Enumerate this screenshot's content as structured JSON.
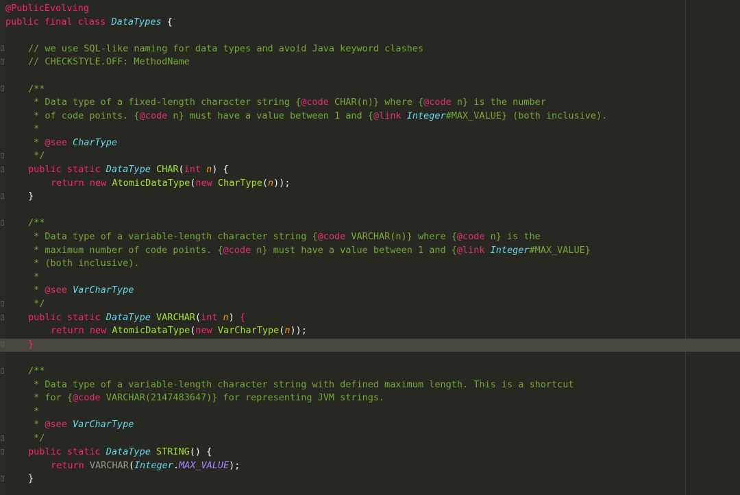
{
  "editor": {
    "lines": [
      [
        {
          "t": "@PublicEvolving",
          "c": "ann"
        }
      ],
      [
        {
          "t": "public final class ",
          "c": "kw"
        },
        {
          "t": "DataTypes",
          "c": "type"
        },
        {
          "t": " {",
          "c": "pun"
        }
      ],
      [],
      [
        {
          "t": "// we use SQL-like naming for data types and avoid Java keyword clashes",
          "c": "cm"
        }
      ],
      [
        {
          "t": "// CHECKSTYLE.OFF: MethodName",
          "c": "cm"
        }
      ],
      [],
      [
        {
          "t": "/**",
          "c": "cm"
        }
      ],
      [
        {
          "t": " * Data type of a fixed-length character string {",
          "c": "cm"
        },
        {
          "t": "@code",
          "c": "tag"
        },
        {
          "t": " CHAR(n)} where {",
          "c": "cm"
        },
        {
          "t": "@code",
          "c": "tag"
        },
        {
          "t": " n} is the number",
          "c": "cm"
        }
      ],
      [
        {
          "t": " * of code points. {",
          "c": "cm"
        },
        {
          "t": "@code",
          "c": "tag"
        },
        {
          "t": " n} must have a value between 1 and {",
          "c": "cm"
        },
        {
          "t": "@link",
          "c": "tag"
        },
        {
          "t": " Integer",
          "c": "link"
        },
        {
          "t": "#MAX_VALUE} (both inclusive).",
          "c": "cm"
        }
      ],
      [
        {
          "t": " *",
          "c": "cm"
        }
      ],
      [
        {
          "t": " * ",
          "c": "cm"
        },
        {
          "t": "@see",
          "c": "tag"
        },
        {
          "t": " CharType",
          "c": "link"
        }
      ],
      [
        {
          "t": " */",
          "c": "cm"
        }
      ],
      [
        {
          "t": "public static ",
          "c": "kw"
        },
        {
          "t": "DataType",
          "c": "type"
        },
        {
          "t": " CHAR",
          "c": "fn"
        },
        {
          "t": "(",
          "c": "pun"
        },
        {
          "t": "int",
          "c": "kw"
        },
        {
          "t": " n",
          "c": "par"
        },
        {
          "t": ") {",
          "c": "pun"
        }
      ],
      [
        {
          "t": "return new ",
          "c": "kw"
        },
        {
          "t": "AtomicDataType",
          "c": "fn"
        },
        {
          "t": "(",
          "c": "pun"
        },
        {
          "t": "new ",
          "c": "kw"
        },
        {
          "t": "CharType",
          "c": "fn"
        },
        {
          "t": "(",
          "c": "pun"
        },
        {
          "t": "n",
          "c": "par"
        },
        {
          "t": "));",
          "c": "pun"
        }
      ],
      [
        {
          "t": "}",
          "c": "pun"
        }
      ],
      [],
      [
        {
          "t": "/**",
          "c": "cm"
        }
      ],
      [
        {
          "t": " * Data type of a variable-length character string {",
          "c": "cm"
        },
        {
          "t": "@code",
          "c": "tag"
        },
        {
          "t": " VARCHAR(n)} where {",
          "c": "cm"
        },
        {
          "t": "@code",
          "c": "tag"
        },
        {
          "t": " n} is the",
          "c": "cm"
        }
      ],
      [
        {
          "t": " * maximum number of code points. {",
          "c": "cm"
        },
        {
          "t": "@code",
          "c": "tag"
        },
        {
          "t": " n} must have a value between 1 and {",
          "c": "cm"
        },
        {
          "t": "@link",
          "c": "tag"
        },
        {
          "t": " Integer",
          "c": "link"
        },
        {
          "t": "#MAX_VALUE}",
          "c": "cm"
        }
      ],
      [
        {
          "t": " * (both inclusive).",
          "c": "cm"
        }
      ],
      [
        {
          "t": " *",
          "c": "cm"
        }
      ],
      [
        {
          "t": " * ",
          "c": "cm"
        },
        {
          "t": "@see",
          "c": "tag"
        },
        {
          "t": " VarCharType",
          "c": "link"
        }
      ],
      [
        {
          "t": " */",
          "c": "cm"
        }
      ],
      [
        {
          "t": "public static ",
          "c": "kw"
        },
        {
          "t": "DataType",
          "c": "type"
        },
        {
          "t": " VARCHAR",
          "c": "fn"
        },
        {
          "t": "(",
          "c": "pun"
        },
        {
          "t": "int",
          "c": "kw"
        },
        {
          "t": " n",
          "c": "par"
        },
        {
          "t": ") ",
          "c": "pun"
        },
        {
          "t": "{",
          "c": "ann"
        }
      ],
      [
        {
          "t": "return new ",
          "c": "kw"
        },
        {
          "t": "AtomicDataType",
          "c": "fn"
        },
        {
          "t": "(",
          "c": "pun"
        },
        {
          "t": "new ",
          "c": "kw"
        },
        {
          "t": "VarCharType",
          "c": "fn"
        },
        {
          "t": "(",
          "c": "pun"
        },
        {
          "t": "n",
          "c": "par"
        },
        {
          "t": "));",
          "c": "pun"
        }
      ],
      [
        {
          "t": "}",
          "c": "ann"
        }
      ],
      [],
      [
        {
          "t": "/**",
          "c": "cm"
        }
      ],
      [
        {
          "t": " * Data type of a variable-length character string with defined maximum length. This is a shortcut",
          "c": "cm"
        }
      ],
      [
        {
          "t": " * for {",
          "c": "cm"
        },
        {
          "t": "@code",
          "c": "tag"
        },
        {
          "t": " VARCHAR(2147483647)} for representing JVM strings.",
          "c": "cm"
        }
      ],
      [
        {
          "t": " *",
          "c": "cm"
        }
      ],
      [
        {
          "t": " * ",
          "c": "cm"
        },
        {
          "t": "@see",
          "c": "tag"
        },
        {
          "t": " VarCharType",
          "c": "link"
        }
      ],
      [
        {
          "t": " */",
          "c": "cm"
        }
      ],
      [
        {
          "t": "public static ",
          "c": "kw"
        },
        {
          "t": "DataType",
          "c": "type"
        },
        {
          "t": " STRING",
          "c": "fn"
        },
        {
          "t": "() {",
          "c": "pun"
        }
      ],
      [
        {
          "t": "return ",
          "c": "kw"
        },
        {
          "t": "VARCHAR",
          "c": "varchar-call"
        },
        {
          "t": "(",
          "c": "pun"
        },
        {
          "t": "Integer",
          "c": "type"
        },
        {
          "t": ".",
          "c": "pun"
        },
        {
          "t": "MAX_VALUE",
          "c": "maxv"
        },
        {
          "t": ");",
          "c": "pun"
        }
      ],
      [
        {
          "t": "}",
          "c": "pun"
        }
      ]
    ]
  },
  "colors": {
    "background": "#272822",
    "current_line": "#48483f"
  }
}
